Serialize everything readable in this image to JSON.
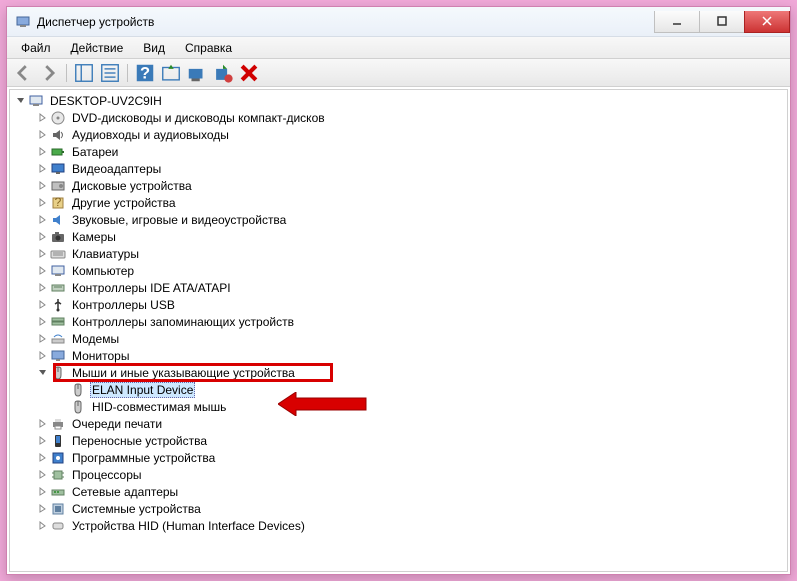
{
  "window": {
    "title": "Диспетчер устройств"
  },
  "menu": {
    "file": "Файл",
    "action": "Действие",
    "view": "Вид",
    "help": "Справка"
  },
  "tree": {
    "root": "DESKTOP-UV2C9IH",
    "items": [
      {
        "label": "DVD-дисководы и дисководы компакт-дисков",
        "icon": "dvd"
      },
      {
        "label": "Аудиовходы и аудиовыходы",
        "icon": "audio"
      },
      {
        "label": "Батареи",
        "icon": "battery"
      },
      {
        "label": "Видеоадаптеры",
        "icon": "display"
      },
      {
        "label": "Дисковые устройства",
        "icon": "disk"
      },
      {
        "label": "Другие устройства",
        "icon": "other"
      },
      {
        "label": "Звуковые, игровые и видеоустройства",
        "icon": "sound"
      },
      {
        "label": "Камеры",
        "icon": "camera"
      },
      {
        "label": "Клавиатуры",
        "icon": "keyboard"
      },
      {
        "label": "Компьютер",
        "icon": "computer"
      },
      {
        "label": "Контроллеры IDE ATA/ATAPI",
        "icon": "ide"
      },
      {
        "label": "Контроллеры USB",
        "icon": "usb"
      },
      {
        "label": "Контроллеры запоминающих устройств",
        "icon": "storage"
      },
      {
        "label": "Модемы",
        "icon": "modem"
      },
      {
        "label": "Мониторы",
        "icon": "monitor"
      },
      {
        "label": "Мыши и иные указывающие устройства",
        "icon": "mouse",
        "expanded": true,
        "children": [
          {
            "label": "ELAN Input Device",
            "icon": "mouse",
            "selected": true
          },
          {
            "label": "HID-совместимая мышь",
            "icon": "mouse"
          }
        ]
      },
      {
        "label": "Очереди печати",
        "icon": "printer"
      },
      {
        "label": "Переносные устройства",
        "icon": "portable"
      },
      {
        "label": "Программные устройства",
        "icon": "software"
      },
      {
        "label": "Процессоры",
        "icon": "cpu"
      },
      {
        "label": "Сетевые адаптеры",
        "icon": "network"
      },
      {
        "label": "Системные устройства",
        "icon": "system"
      },
      {
        "label": "Устройства HID (Human Interface Devices)",
        "icon": "hid"
      }
    ]
  }
}
